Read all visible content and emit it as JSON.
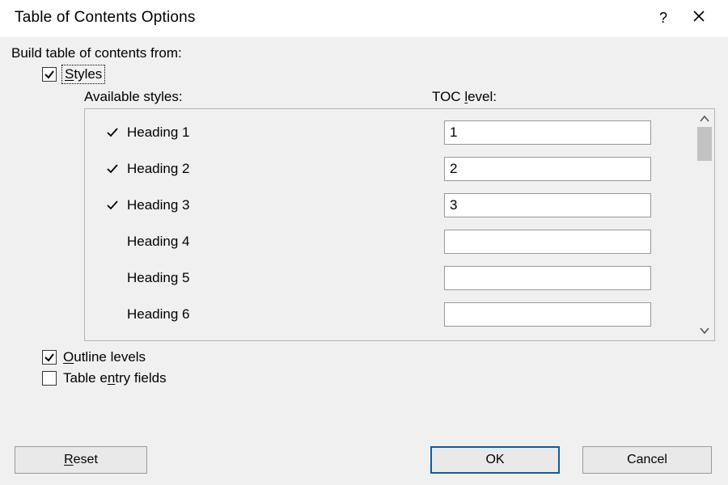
{
  "title": "Table of Contents Options",
  "build_label": "Build table of contents from:",
  "styles_checkbox": {
    "checked": true,
    "label": "Styles"
  },
  "headers": {
    "available": "Available styles:",
    "toc": "TOC level:"
  },
  "styles": [
    {
      "checked": true,
      "name": "Heading 1",
      "level": "1"
    },
    {
      "checked": true,
      "name": "Heading 2",
      "level": "2"
    },
    {
      "checked": true,
      "name": "Heading 3",
      "level": "3"
    },
    {
      "checked": false,
      "name": "Heading 4",
      "level": ""
    },
    {
      "checked": false,
      "name": "Heading 5",
      "level": ""
    },
    {
      "checked": false,
      "name": "Heading 6",
      "level": ""
    }
  ],
  "outline_levels": {
    "checked": true,
    "label_pre": "O",
    "label_post": "utline levels"
  },
  "table_entry": {
    "checked": false,
    "label_pre": "Table e",
    "label_mid": "n",
    "label_post": "try fields"
  },
  "buttons": {
    "reset_pre": "R",
    "reset_post": "eset",
    "ok": "OK",
    "cancel": "Cancel"
  },
  "toc_underline": "l",
  "styles_underline": "S",
  "styles_rest": "tyles"
}
